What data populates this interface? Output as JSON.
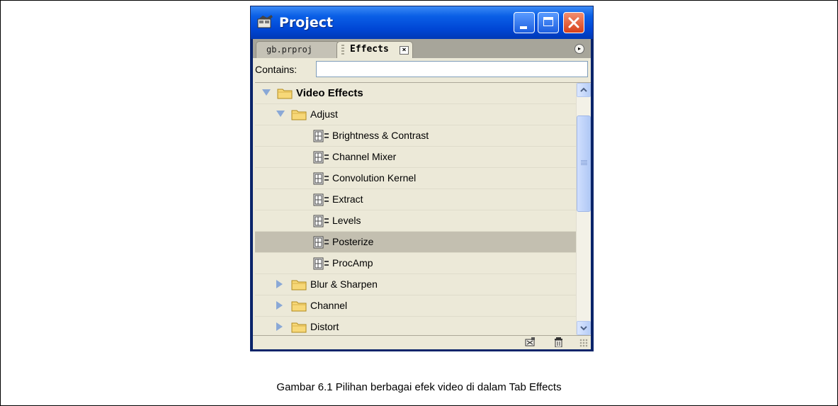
{
  "window": {
    "title": "Project",
    "controls": [
      "minimize-button",
      "maximize-button",
      "close-button"
    ]
  },
  "tabs": [
    {
      "label": "gb.prproj",
      "active": false
    },
    {
      "label": "Effects",
      "active": true,
      "close_glyph": "×"
    }
  ],
  "panel_menu_glyph": "▸",
  "search": {
    "label": "Contains:",
    "value": ""
  },
  "tree": [
    {
      "label": "Video Effects",
      "type": "folder",
      "expanded": true,
      "depth": 0,
      "bold": true
    },
    {
      "label": "Adjust",
      "type": "folder",
      "expanded": true,
      "depth": 1
    },
    {
      "label": "Brightness & Contrast",
      "type": "effect",
      "depth": 2
    },
    {
      "label": "Channel Mixer",
      "type": "effect",
      "depth": 2
    },
    {
      "label": "Convolution Kernel",
      "type": "effect",
      "depth": 2
    },
    {
      "label": "Extract",
      "type": "effect",
      "depth": 2
    },
    {
      "label": "Levels",
      "type": "effect",
      "depth": 2
    },
    {
      "label": "Posterize",
      "type": "effect",
      "depth": 2,
      "selected": true
    },
    {
      "label": "ProcAmp",
      "type": "effect",
      "depth": 2
    },
    {
      "label": "Blur & Sharpen",
      "type": "folder",
      "expanded": false,
      "depth": 1
    },
    {
      "label": "Channel",
      "type": "folder",
      "expanded": false,
      "depth": 1
    },
    {
      "label": "Distort",
      "type": "folder",
      "expanded": false,
      "depth": 1
    }
  ],
  "statusbar": {
    "icons": [
      "new-custom-bin-icon",
      "trash-icon"
    ]
  },
  "caption": "Gambar 6.1 Pilihan berbagai efek video di dalam Tab Effects",
  "colors": {
    "title_bar": "#0046d5",
    "panel_bg": "#ece9d8",
    "selected_row": "#c3bfb0",
    "close_button": "#d7401a"
  }
}
